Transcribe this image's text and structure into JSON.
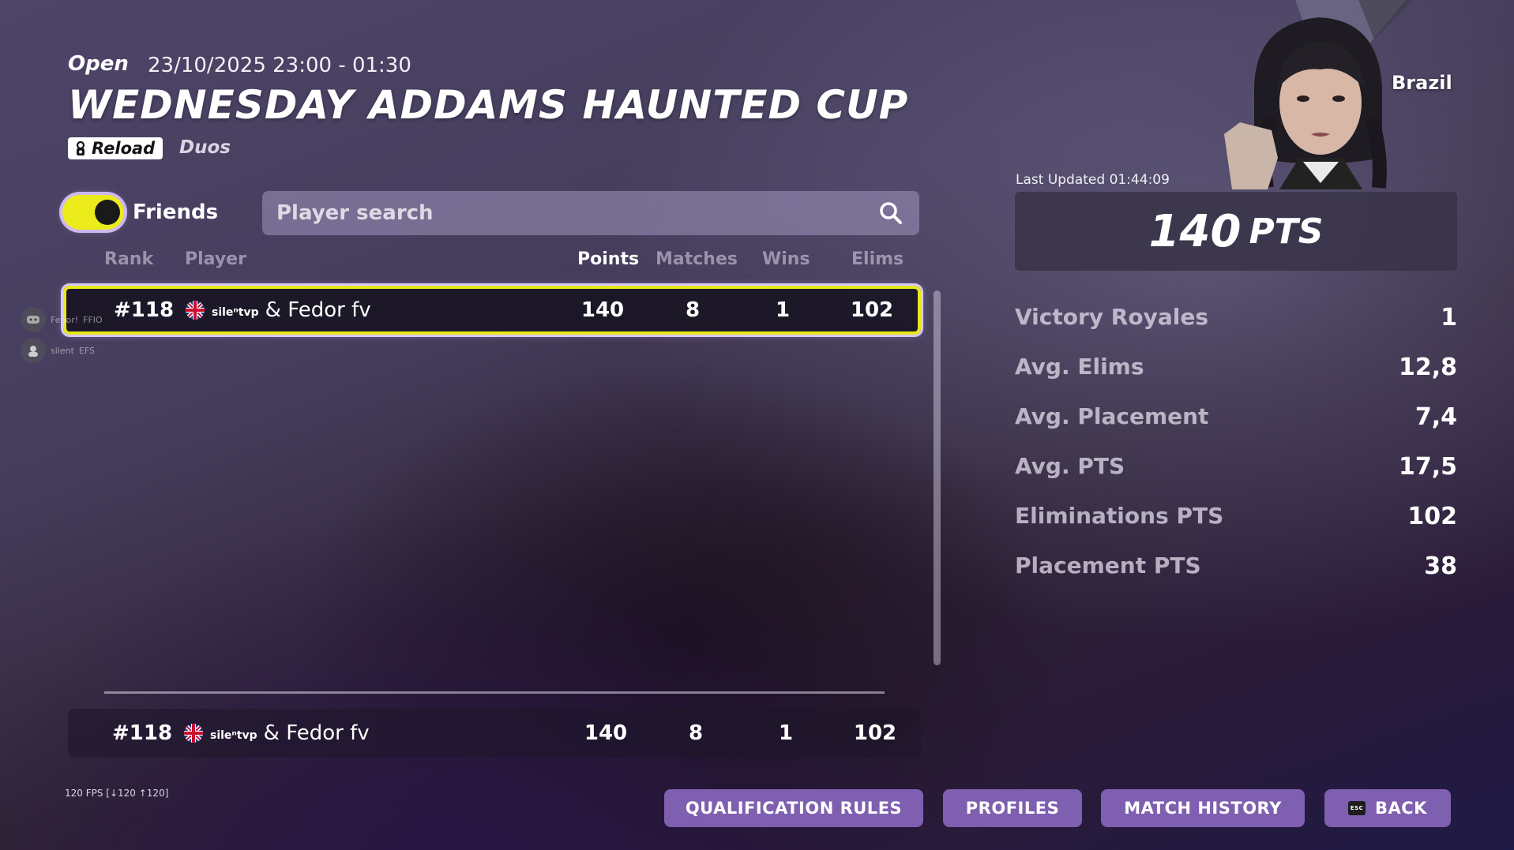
{
  "event": {
    "status": "Open",
    "datetime": "23/10/2025 23:00 - 01:30",
    "title": "WEDNESDAY ADDAMS HAUNTED CUP",
    "mode": "Reload",
    "team_size": "Duos"
  },
  "filters": {
    "friends_label": "Friends",
    "friends_on": true,
    "search_placeholder": "Player search"
  },
  "table": {
    "headers": {
      "rank": "Rank",
      "player": "Player",
      "points": "Points",
      "matches": "Matches",
      "wins": "Wins",
      "elims": "Elims"
    },
    "rows": [
      {
        "rank": "#118",
        "player_a": "sileⁿtvp",
        "player_b": "& Fedor fv",
        "points": "140",
        "matches": "8",
        "wins": "1",
        "elims": "102"
      }
    ],
    "footer": {
      "rank": "#118",
      "player_a": "sileⁿtvp",
      "player_b": "& Fedor fv",
      "points": "140",
      "matches": "8",
      "wins": "1",
      "elims": "102"
    }
  },
  "overlay": {
    "user1": {
      "name": "Fedor!",
      "tag": "FFIO"
    },
    "user2": {
      "name": "silent",
      "tag": "EFS"
    }
  },
  "profile": {
    "country": "Brazil",
    "last_updated": "Last Updated 01:44:09",
    "total_points": "140",
    "points_unit": "PTS",
    "stats": [
      {
        "label": "Victory Royales",
        "value": "1"
      },
      {
        "label": "Avg. Elims",
        "value": "12,8"
      },
      {
        "label": "Avg. Placement",
        "value": "7,4"
      },
      {
        "label": "Avg. PTS",
        "value": "17,5"
      },
      {
        "label": "Eliminations PTS",
        "value": "102"
      },
      {
        "label": "Placement PTS",
        "value": "38"
      }
    ]
  },
  "footer": {
    "fps": "120 FPS [↓120 ↑120]",
    "buttons": {
      "qualification": "QUALIFICATION RULES",
      "profiles": "PROFILES",
      "match_history": "MATCH HISTORY",
      "back": "BACK",
      "back_key": "ESC"
    }
  },
  "colors": {
    "highlight_border": "#e8e81a",
    "toggle_on": "#ecec1c",
    "button_bg": "#7e5fb0"
  }
}
